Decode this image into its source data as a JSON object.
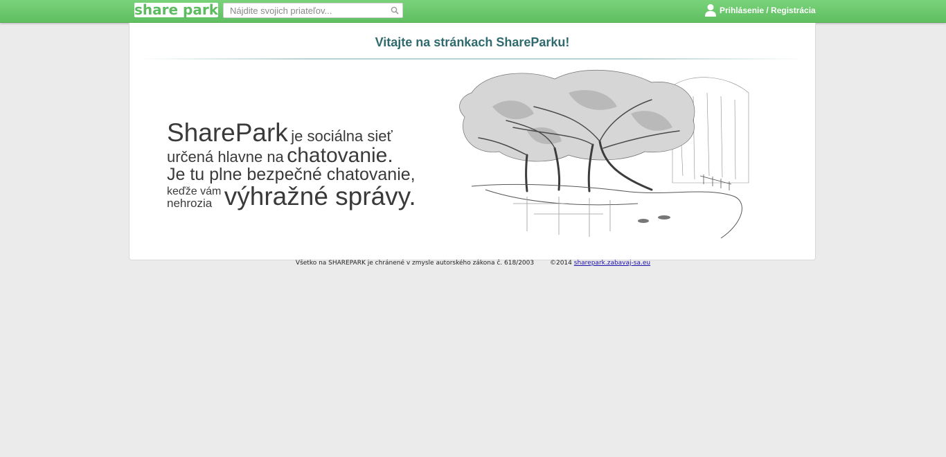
{
  "header": {
    "logo_text": "share park",
    "search": {
      "placeholder": "Nájdite svojich priateľov..."
    },
    "login_label": "Prihlásenie / Registrácia",
    "accent_color": "#68c76a"
  },
  "main": {
    "title": "Vitajte na stránkach ShareParku!",
    "tagline": {
      "line1_big": "SharePark",
      "line1_small": "je sociálna sieť",
      "line2_small": "určená hlavne na",
      "line2_big": "chatovanie.",
      "line3": "Je tu plne bezpečné chatovanie,",
      "line4_small_a": "keďže vám",
      "line4_small_b": "nehrozia",
      "line4_big": "výhražné správy."
    },
    "illustration": "pencil-sketch-park-tree-pond"
  },
  "footer": {
    "notice": "Všetko na SHAREPARK je chránené v zmysle autorského zákona č. 618/2003",
    "copyright": "©2014",
    "link_text": "sharepark.zabavaj-sa.eu"
  }
}
